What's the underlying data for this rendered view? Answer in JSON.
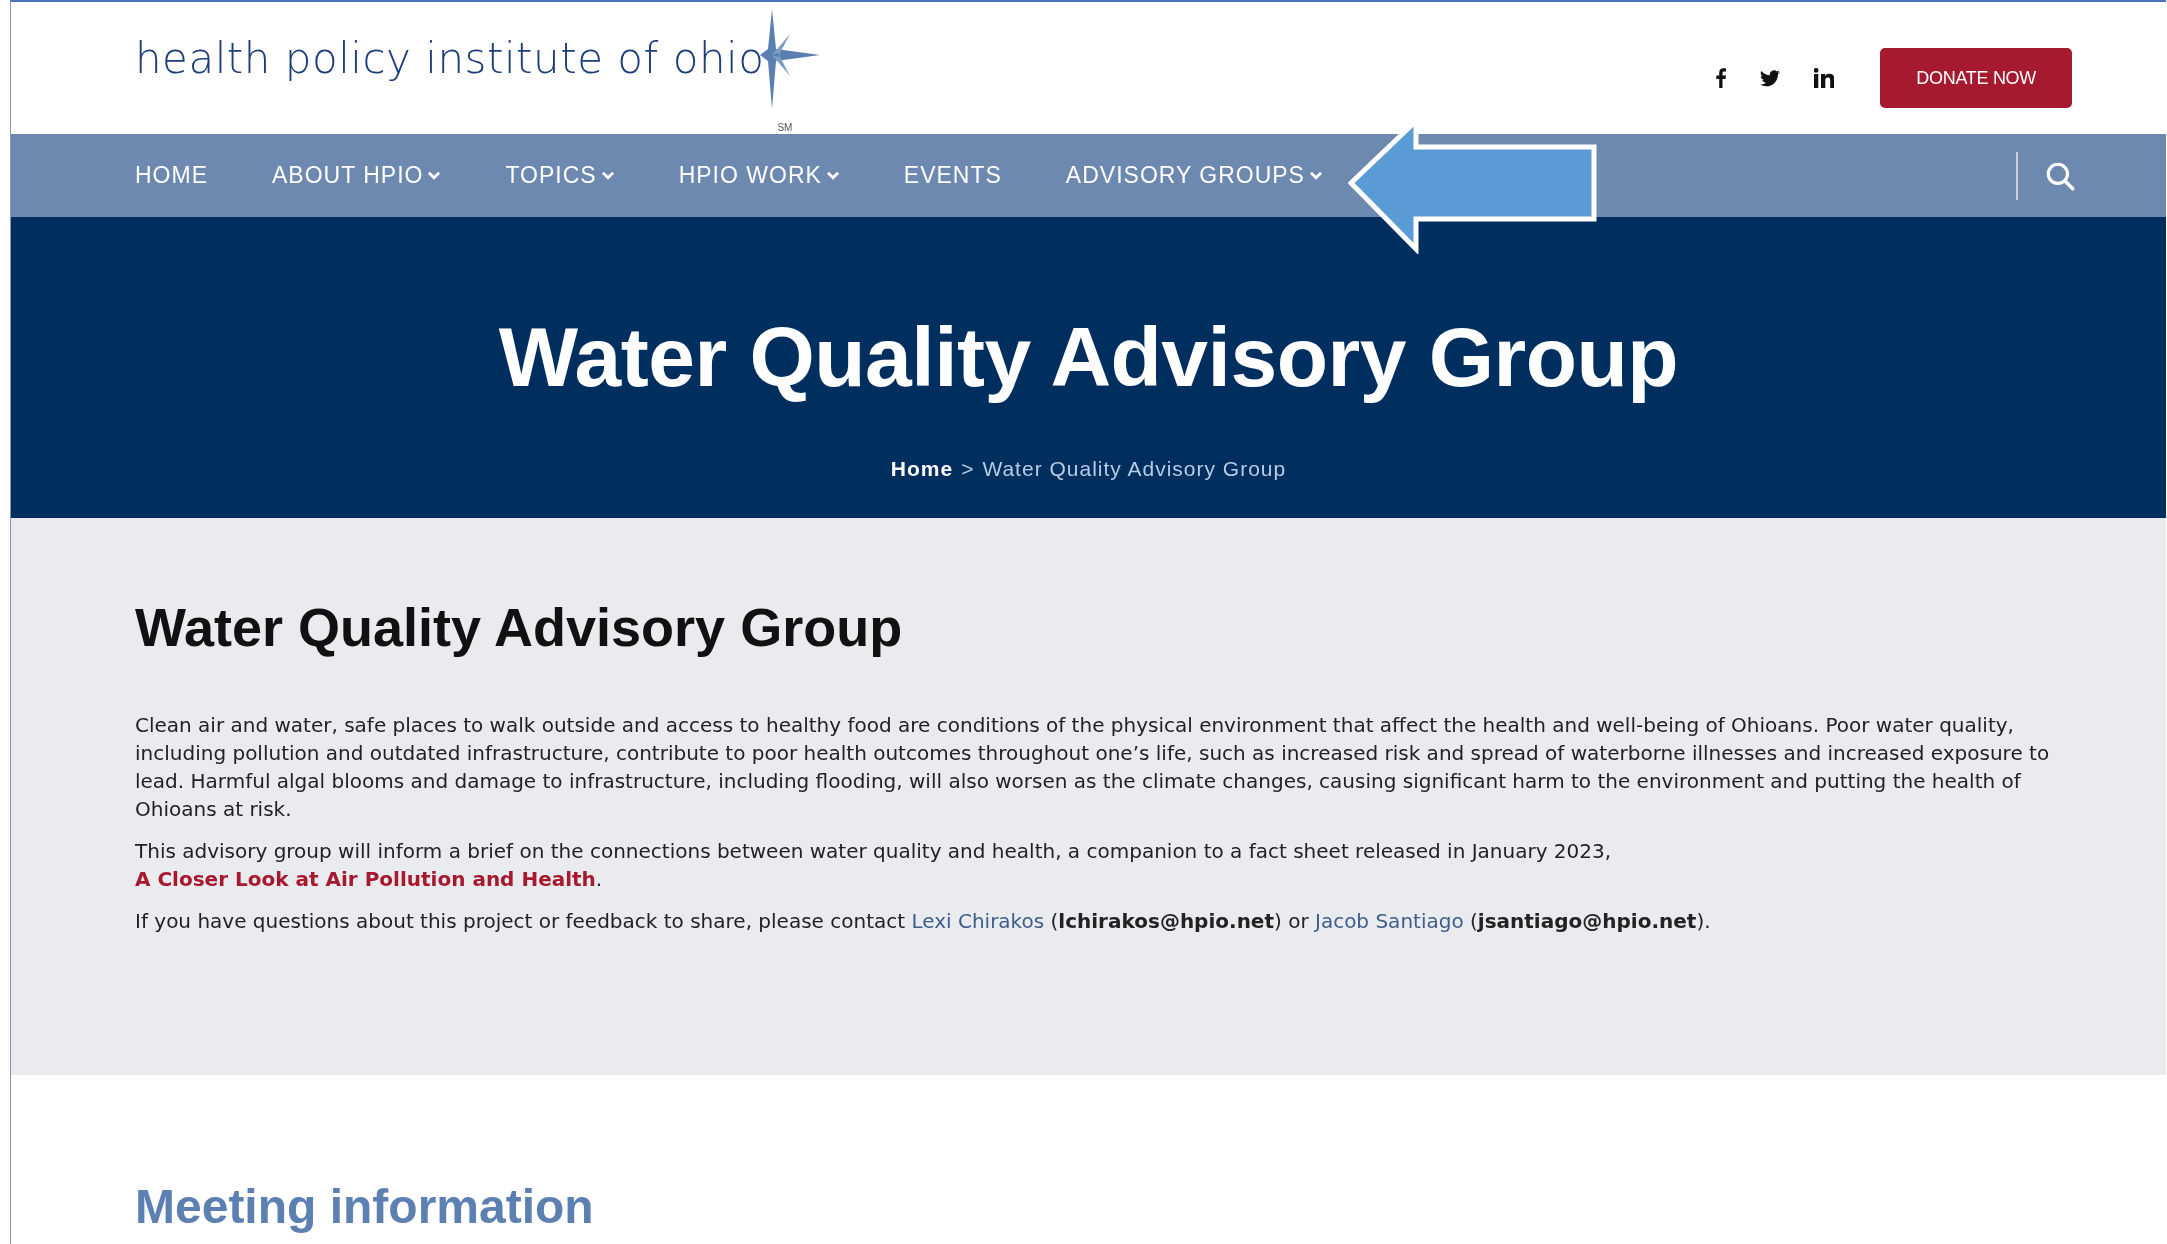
{
  "header": {
    "logo": {
      "text": "health policy institute of ohio",
      "trademark": "SM"
    },
    "social": [
      {
        "kind": "facebook"
      },
      {
        "kind": "twitter"
      },
      {
        "kind": "linkedin"
      }
    ],
    "donate_button": "DONATE NOW"
  },
  "nav": {
    "items": [
      {
        "label": "HOME",
        "dropdown": false
      },
      {
        "label": "ABOUT HPIO",
        "dropdown": true
      },
      {
        "label": "TOPICS",
        "dropdown": true
      },
      {
        "label": "HPIO WORK",
        "dropdown": true
      },
      {
        "label": "EVENTS",
        "dropdown": false
      },
      {
        "label": "ADVISORY GROUPS",
        "dropdown": true
      }
    ]
  },
  "hero": {
    "title": "Water Quality Advisory Group",
    "breadcrumb": [
      {
        "label": "Home",
        "kind": "link"
      },
      {
        "label": ">",
        "kind": "separator"
      },
      {
        "label": "Water Quality Advisory Group",
        "kind": "current"
      }
    ]
  },
  "content": {
    "heading": "Water Quality Advisory Group",
    "paragraphs": [
      [
        {
          "kind": "text",
          "text": "Clean air and water, safe places to walk outside and access to healthy food are conditions of the physical environment that affect the health and well-being of Ohioans. Poor water quality, including pollution and outdated infrastructure, contribute to poor health outcomes throughout one’s life, such as increased risk and spread of waterborne illnesses and increased exposure to lead. Harmful algal blooms and damage to infrastructure, including flooding, will also worsen as the climate changes, causing significant harm to the environment and putting the health of Ohioans at risk."
        }
      ],
      [
        {
          "kind": "text",
          "text": "This advisory group will inform a brief on the connections between water quality and health, a companion to a fact sheet released in January 2023, "
        },
        {
          "kind": "report-link",
          "text": "A Closer Look at Air Pollution and Health"
        },
        {
          "kind": "text",
          "text": "."
        }
      ],
      [
        {
          "kind": "text",
          "text": "If you have questions about this project or feedback to share, please contact "
        },
        {
          "kind": "person-link",
          "text": "Lexi Chirakos"
        },
        {
          "kind": "text",
          "text": " (**lchirakos@hpio.net**) or "
        },
        {
          "kind": "person-link",
          "text": "Jacob Santiago"
        },
        {
          "kind": "text",
          "text": " (**jsantiago@hpio.net**)."
        }
      ]
    ]
  },
  "meeting": {
    "heading": "Meeting information"
  }
}
